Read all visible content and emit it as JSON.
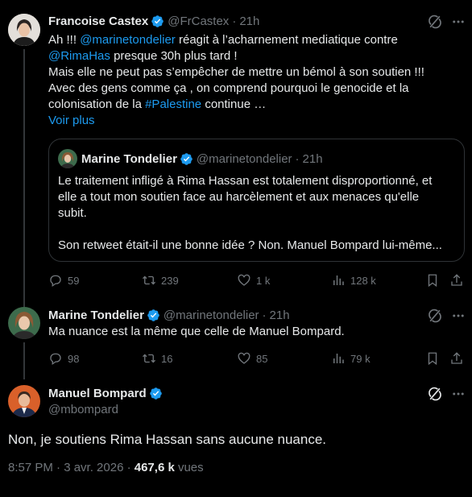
{
  "tweet1": {
    "name": "Francoise Castex",
    "handle": "@FrCastex",
    "time": "21h",
    "line1_a": "Ah !!! ",
    "line1_mention": "@marinetondelier",
    "line1_b": " réagit à l’acharnement mediatique contre",
    "line2_mention": "@RimaHas",
    "line2_b": " presque 30h plus tard !",
    "line3": "Mais elle ne peut pas s’empêcher de mettre un bémol à son soutien !!!",
    "line4": "Avec des gens comme ça , on comprend pourquoi le genocide et la",
    "line5_a": "colonisation de la ",
    "line5_hashtag": "#Palestine",
    "line5_b": " continue …",
    "see_more": "Voir plus",
    "quote": {
      "name": "Marine Tondelier",
      "handle": "@marinetondelier",
      "time": "21h",
      "line1": "Le traitement infligé à Rima Hassan est totalement disproportionné, et",
      "line2": "elle a tout mon soutien face au harcèlement et aux menaces qu'elle",
      "line3": "subit.",
      "line4": "Son retweet était-il une bonne idée ? Non. Manuel Bompard lui-même..."
    },
    "stats": {
      "replies": "59",
      "retweets": "239",
      "likes": "1 k",
      "views": "128 k"
    }
  },
  "tweet2": {
    "name": "Marine Tondelier",
    "handle": "@marinetondelier",
    "time": "21h",
    "text": "Ma nuance est la même que celle de Manuel Bompard.",
    "stats": {
      "replies": "98",
      "retweets": "16",
      "likes": "85",
      "views": "79 k"
    }
  },
  "tweet3": {
    "name": "Manuel Bompard",
    "handle": "@mbompard",
    "text": "Non, je soutiens Rima Hassan sans aucune nuance.",
    "date": "8:57 PM · 3 avr. 2026 · ",
    "views_count": "467,6 k",
    "views_label": " vues"
  },
  "colors": {
    "accent": "#1d9bf0",
    "muted": "#71767b",
    "verified": "#1d9bf0"
  },
  "icons": [
    "verified-icon",
    "grok-icon",
    "more-icon",
    "reply-icon",
    "retweet-icon",
    "like-icon",
    "views-icon",
    "bookmark-icon",
    "share-icon"
  ]
}
